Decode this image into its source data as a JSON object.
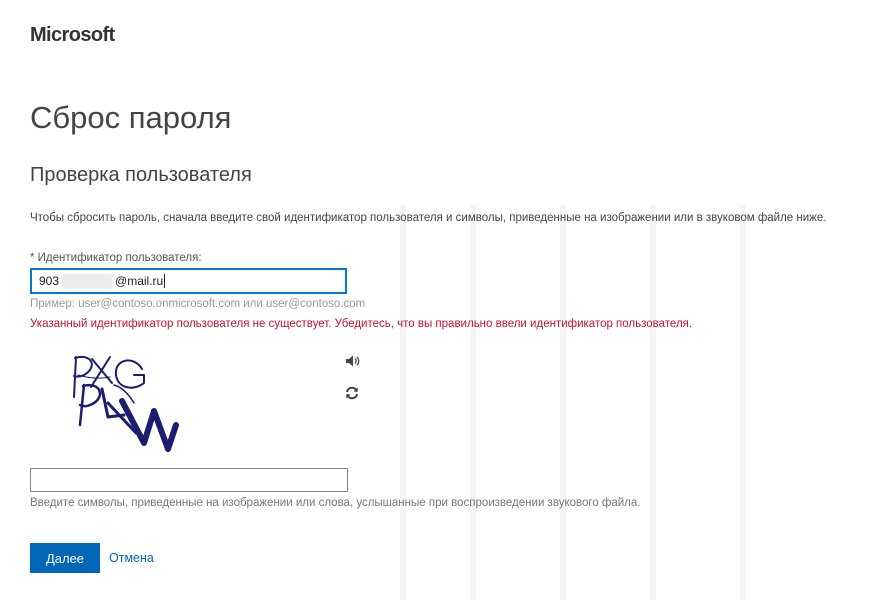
{
  "brand": {
    "name": "Microsoft"
  },
  "page": {
    "title": "Сброс пароля",
    "subtitle": "Проверка пользователя",
    "instructions": "Чтобы сбросить пароль, сначала введите свой идентификатор пользователя и символы, приведенные на изображении или в звуковом файле ниже."
  },
  "user_id": {
    "label": "* Идентификатор пользователя:",
    "value_prefix": "903",
    "value_suffix": "@mail.ru",
    "example": "Пример: user@contoso.onmicrosoft.com или user@contoso.com",
    "error": "Указанный идентификатор пользователя не существует. Убедитесь, что вы правильно ввели идентификатор пользователя."
  },
  "captcha": {
    "image_text": "PXG PLW",
    "input_value": "",
    "hint": "Введите символы, приведенные на изображении или слова, услышанные при воспроизведении звукового файла.",
    "audio_icon": "speaker-icon",
    "refresh_icon": "refresh-icon"
  },
  "actions": {
    "next_label": "Далее",
    "cancel_label": "Отмена"
  },
  "colors": {
    "accent": "#0067b8",
    "error": "#c8102e",
    "captcha_ink": "#1b1d6e",
    "focus_border": "#0078d7"
  }
}
